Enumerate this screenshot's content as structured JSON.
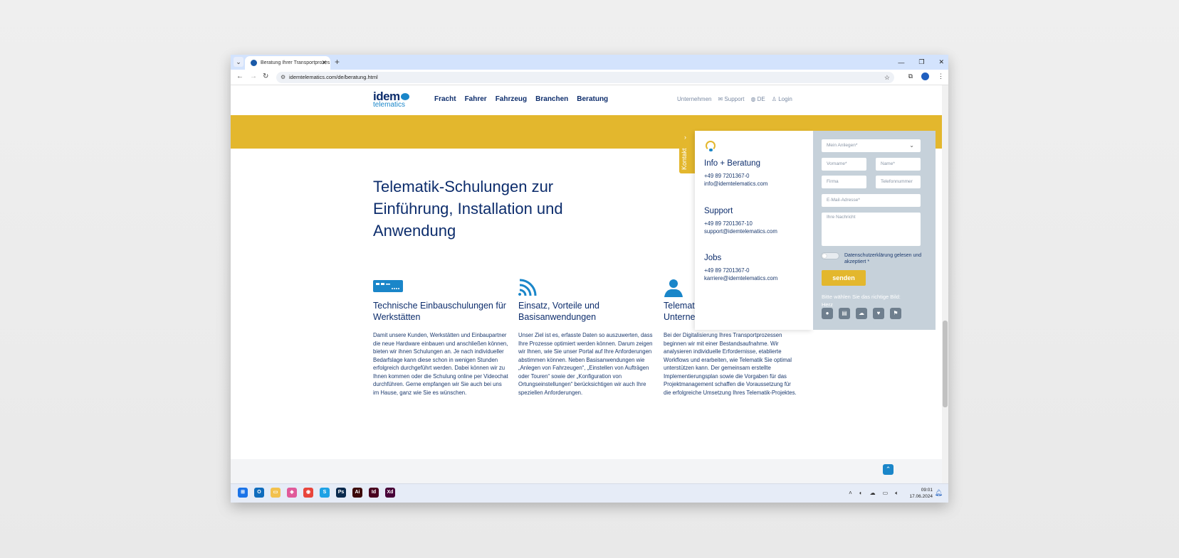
{
  "browser": {
    "tab_title": "Beratung Ihrer Transportprozes",
    "url": "idemtelematics.com/de/beratung.html"
  },
  "site": {
    "logo_main": "idem",
    "logo_sub": "telematics",
    "nav": [
      "Fracht",
      "Fahrer",
      "Fahrzeug",
      "Branchen",
      "Beratung"
    ],
    "meta_nav": {
      "company": "Unternehmen",
      "support": "Support",
      "language": "DE",
      "login": "Login"
    }
  },
  "hero": {
    "title": "Telematik-Schulungen zur Einführung, Installation und Anwendung"
  },
  "columns": [
    {
      "icon": "hardware-device-icon",
      "title": "Technische Einbauschulungen für Werkstätten",
      "text": "Damit unsere Kunden, Werkstätten und Einbaupartner die neue Hardware einbauen und anschließen können, bieten wir ihnen Schulungen an. Je nach individueller Bedarfslage kann diese schon in wenigen Stunden erfolgreich durchgeführt werden. Dabei können wir zu Ihnen kommen oder die Schulung online per Videochat durchführen. Gerne empfangen wir Sie auch bei uns im Hause, ganz wie Sie es wünschen."
    },
    {
      "icon": "wireless-signal-icon",
      "title": "Einsatz, Vorteile und Basisanwendungen",
      "text": "Unser Ziel ist es, erfasste Daten so auszuwerten, dass Ihre Prozesse optimiert werden können. Darum zeigen wir Ihnen, wie Sie unser Portal auf Ihre Anforderungen abstimmen können. Neben Basisanwendungen wie „Anlegen von Fahrzeugen“, „Einstellen von Aufträgen oder Touren“ sowie der „Konfiguration von Ortungseinstellungen“ berücksichtigen wir auch Ihre speziellen Anforderungen."
    },
    {
      "icon": "person-icon",
      "title": "Telemat Unterne",
      "text": "Bei der Digitalisierung Ihres Transportprozessen beginnen wir mit einer Bestandsaufnahme. Wir analysieren individuelle Erfordernisse, etablierte Workflows und erarbeiten, wie Telematik Sie optimal unterstützen kann. Der gemeinsam erstellte Implementierungsplan sowie die Vorgaben für das Projektmanagement schaffen die Voraussetzung für die erfolgreiche Umsetzung Ihres Telematik-Projektes."
    }
  ],
  "contact": {
    "tab_label": "Kontakt",
    "blocks": [
      {
        "title": "Info + Beratung",
        "phone": "+49 89 7201367-0",
        "email": "info@idemtelematics.com"
      },
      {
        "title": "Support",
        "phone": "+49 89 7201367-10",
        "email": "support@idemtelematics.com"
      },
      {
        "title": "Jobs",
        "phone": "+49 89 7201367-0",
        "email": "karriere@idemtelematics.com"
      }
    ],
    "form": {
      "concern": "Mein Anliegen*",
      "first_name": "Vorname*",
      "last_name": "Name*",
      "company": "Firma",
      "phone": "Telefonnummer",
      "email": "E-Mail-Adresse*",
      "message": "Ihre Nachricht",
      "privacy": "Datenschutzerklärung gelesen und akzeptiert",
      "privacy_mark": "*",
      "submit": "senden",
      "captcha_label": "Bitte wählen Sie das richtige Bild:",
      "captcha_word": "Herz"
    }
  },
  "taskbar": {
    "time": "09:01",
    "date": "17.06.2024"
  }
}
